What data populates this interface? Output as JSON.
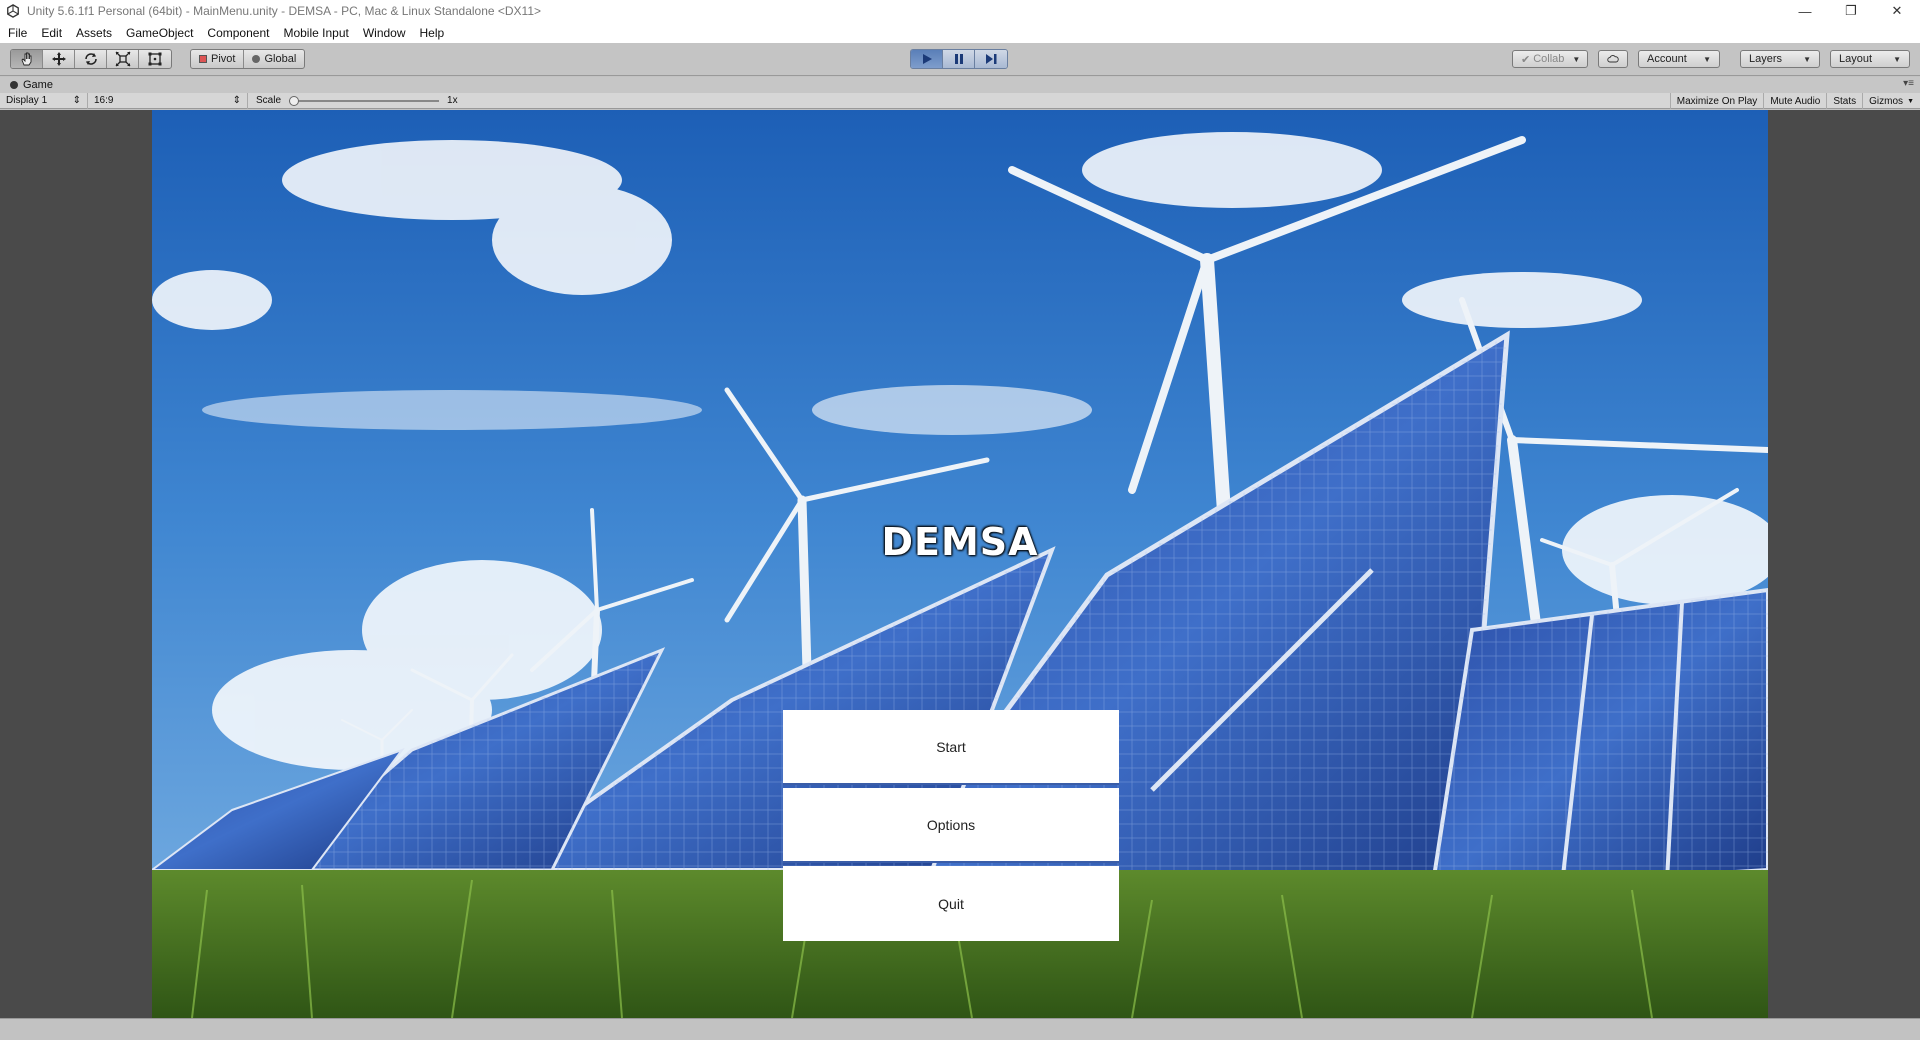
{
  "window": {
    "title": "Unity 5.6.1f1 Personal (64bit) - MainMenu.unity - DEMSA - PC, Mac & Linux Standalone <DX11>"
  },
  "menu": [
    "File",
    "Edit",
    "Assets",
    "GameObject",
    "Component",
    "Mobile Input",
    "Window",
    "Help"
  ],
  "toolbar": {
    "pivot_label": "Pivot",
    "global_label": "Global",
    "collab_label": "Collab",
    "account_label": "Account",
    "layers_label": "Layers",
    "layout_label": "Layout"
  },
  "game_tab": {
    "label": "Game",
    "display": "Display 1",
    "aspect": "16:9",
    "scale_label": "Scale",
    "scale_value": "1x",
    "maximize_on_play": "Maximize On Play",
    "mute_audio": "Mute Audio",
    "stats": "Stats",
    "gizmos": "Gizmos"
  },
  "game": {
    "title": "DEMSA",
    "buttons": [
      "Start",
      "Options",
      "Quit"
    ]
  },
  "colors": {
    "play_active": "#5a7fb8",
    "button_divider": "#3a5da8"
  }
}
